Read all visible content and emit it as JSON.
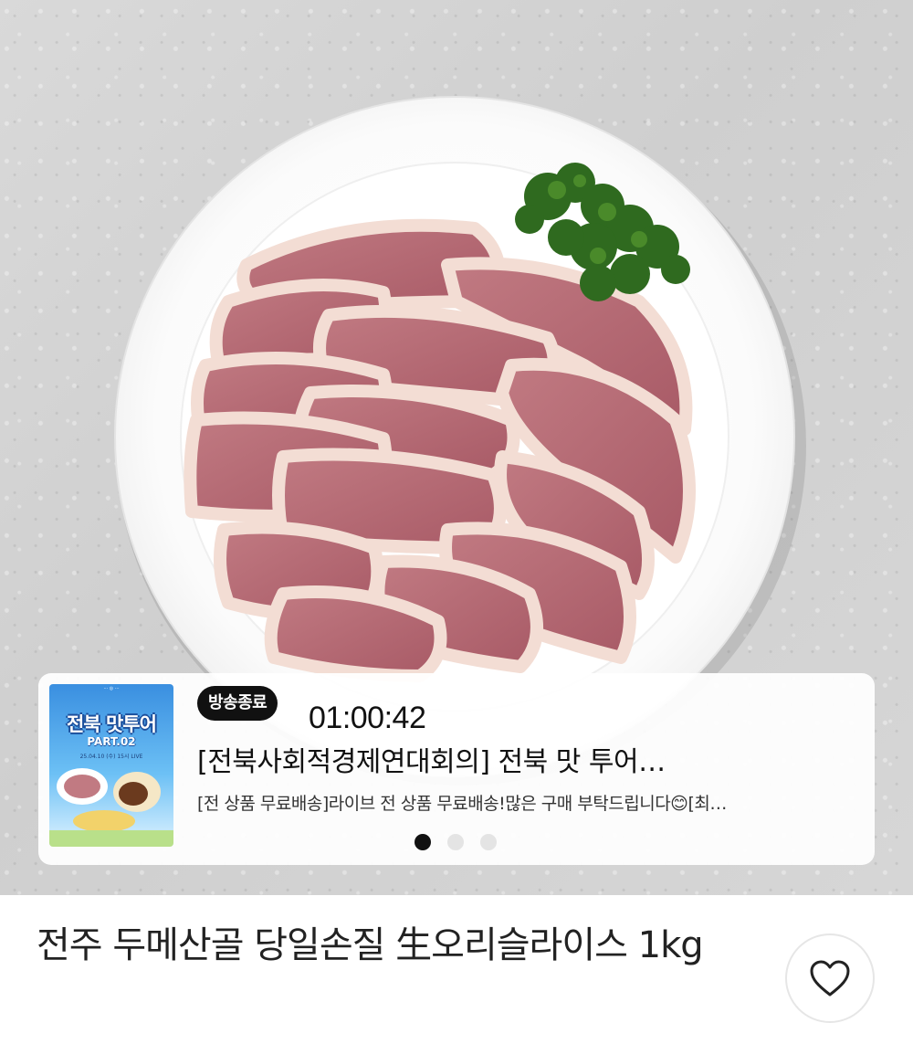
{
  "hero": {
    "image_alt": "생오리 슬라이스 접시 이미지"
  },
  "live": {
    "badge": "방송종료",
    "timer": "01:00:42",
    "title": "[전북사회적경제연대회의] 전북 맛 투어…",
    "subtitle": "[전 상품 무료배송]라이브 전 상품 무료배송!많은 구매 부탁드립니다😊[최…",
    "thumbnail": {
      "logos": "··· ◎ ···",
      "title": "전북 맛투어",
      "part": "PART.02",
      "date": "25.04.10 (수) 15시 LIVE"
    },
    "pagination": {
      "count": 3,
      "active_index": 0
    }
  },
  "product": {
    "name": "전주 두메산골 당일손질 生오리슬라이스 1kg"
  },
  "icons": {
    "wish": "heart-icon"
  },
  "colors": {
    "badge_bg": "#111111",
    "text_primary": "#222222",
    "meat": "#b56a74",
    "fat": "#f2dcd3",
    "parsley": "#2f6a1f"
  }
}
